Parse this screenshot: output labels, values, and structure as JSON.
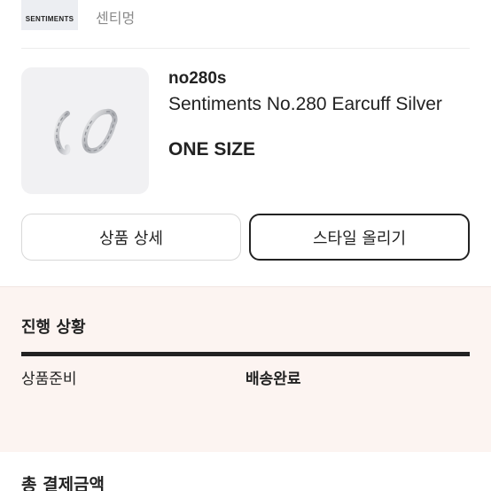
{
  "brand": {
    "logo_text": "SENTIMENTS",
    "name": "센티멍"
  },
  "product": {
    "code": "no280s",
    "name": "Sentiments No.280 Earcuff Silver",
    "size": "ONE SIZE",
    "image_icon": "earcuff-product-image"
  },
  "actions": {
    "detail_label": "상품 상세",
    "style_label": "스타일 올리기"
  },
  "progress": {
    "title": "진행 상황",
    "steps": [
      "상품준비",
      "배송완료"
    ],
    "current_step": 2,
    "fill_fraction": 1.0
  },
  "payment": {
    "total_label": "총 결제금액"
  },
  "colors": {
    "progress_bg": "#fcf4f1",
    "progress_fill": "#222222",
    "progress_track": "#e7dbd6",
    "muted_text": "#8a8a8a"
  }
}
